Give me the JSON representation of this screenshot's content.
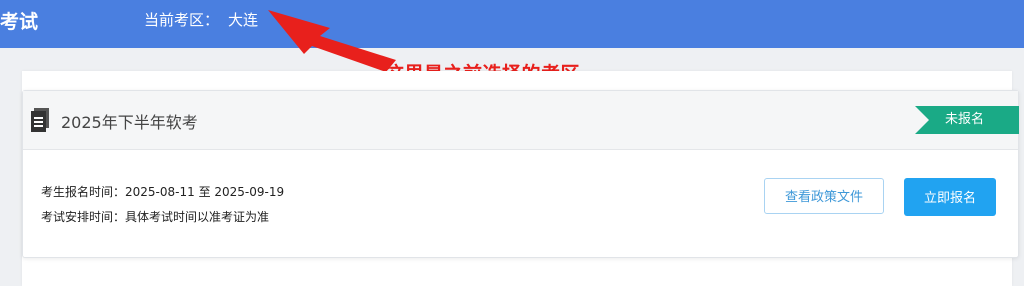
{
  "header": {
    "app_title": "考试",
    "region_label": "当前考区：",
    "region_value": "大连"
  },
  "annotation": {
    "text": "这里是之前选择的考区",
    "color": "#e8201c"
  },
  "exam": {
    "title": "2025年下半年软考",
    "status": "未报名",
    "registration_time_label": "考生报名时间：",
    "registration_time_value": "2025-08-11 至 2025-09-19",
    "schedule_label": "考试安排时间：",
    "schedule_value": "具体考试时间以准考证为准",
    "policy_button": "查看政策文件",
    "register_button": "立即报名",
    "icon": "document-icon"
  },
  "colors": {
    "topbar": "#4a7fe0",
    "status_badge": "#1aaa86",
    "primary_button": "#21a3f1",
    "outline_button": "#3e98d8"
  }
}
